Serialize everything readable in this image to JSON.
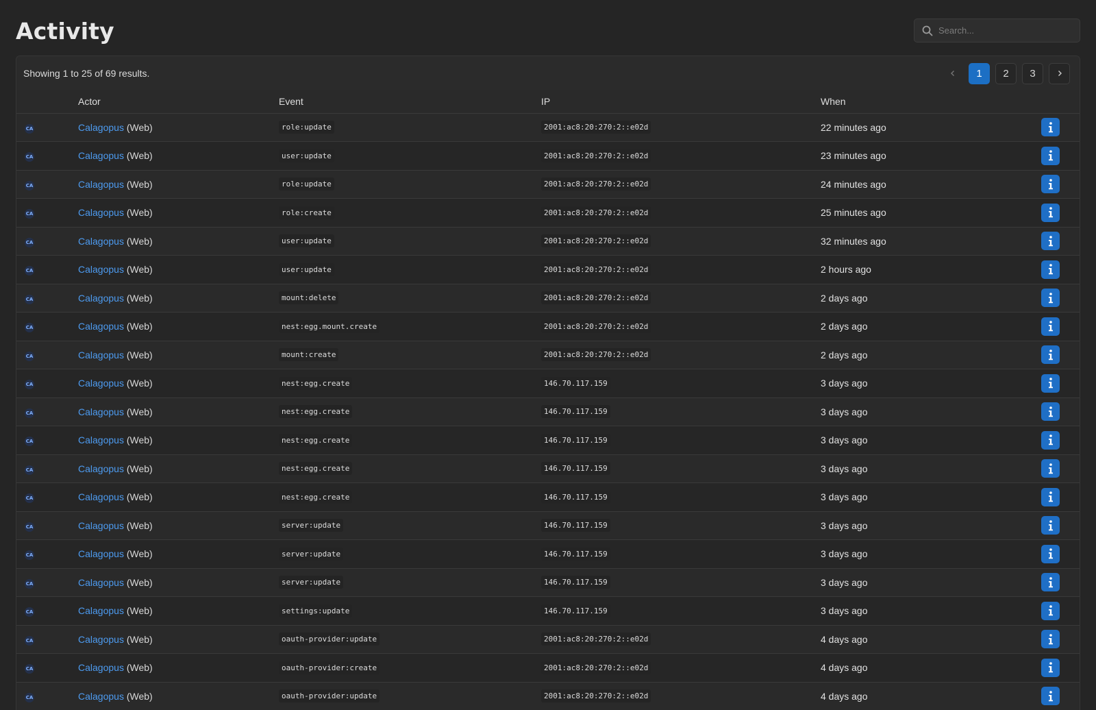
{
  "page": {
    "title": "Activity"
  },
  "search": {
    "placeholder": "Search..."
  },
  "results": {
    "text": "Showing 1 to 25 of 69 results."
  },
  "pagination": {
    "prev_icon": "chevron-left-icon",
    "next_icon": "chevron-right-icon",
    "pages": [
      "1",
      "2",
      "3"
    ],
    "current": "1"
  },
  "table": {
    "columns": {
      "actor": "Actor",
      "event": "Event",
      "ip": "IP",
      "when": "When"
    },
    "rows": [
      {
        "avatar": "CA",
        "actor": "Calagopus",
        "actor_suffix": "(Web)",
        "event": "role:update",
        "ip": "2001:ac8:20:270:2::e02d",
        "when": "22 minutes ago"
      },
      {
        "avatar": "CA",
        "actor": "Calagopus",
        "actor_suffix": "(Web)",
        "event": "user:update",
        "ip": "2001:ac8:20:270:2::e02d",
        "when": "23 minutes ago"
      },
      {
        "avatar": "CA",
        "actor": "Calagopus",
        "actor_suffix": "(Web)",
        "event": "role:update",
        "ip": "2001:ac8:20:270:2::e02d",
        "when": "24 minutes ago"
      },
      {
        "avatar": "CA",
        "actor": "Calagopus",
        "actor_suffix": "(Web)",
        "event": "role:create",
        "ip": "2001:ac8:20:270:2::e02d",
        "when": "25 minutes ago"
      },
      {
        "avatar": "CA",
        "actor": "Calagopus",
        "actor_suffix": "(Web)",
        "event": "user:update",
        "ip": "2001:ac8:20:270:2::e02d",
        "when": "32 minutes ago"
      },
      {
        "avatar": "CA",
        "actor": "Calagopus",
        "actor_suffix": "(Web)",
        "event": "user:update",
        "ip": "2001:ac8:20:270:2::e02d",
        "when": "2 hours ago"
      },
      {
        "avatar": "CA",
        "actor": "Calagopus",
        "actor_suffix": "(Web)",
        "event": "mount:delete",
        "ip": "2001:ac8:20:270:2::e02d",
        "when": "2 days ago"
      },
      {
        "avatar": "CA",
        "actor": "Calagopus",
        "actor_suffix": "(Web)",
        "event": "nest:egg.mount.create",
        "ip": "2001:ac8:20:270:2::e02d",
        "when": "2 days ago"
      },
      {
        "avatar": "CA",
        "actor": "Calagopus",
        "actor_suffix": "(Web)",
        "event": "mount:create",
        "ip": "2001:ac8:20:270:2::e02d",
        "when": "2 days ago"
      },
      {
        "avatar": "CA",
        "actor": "Calagopus",
        "actor_suffix": "(Web)",
        "event": "nest:egg.create",
        "ip": "146.70.117.159",
        "when": "3 days ago"
      },
      {
        "avatar": "CA",
        "actor": "Calagopus",
        "actor_suffix": "(Web)",
        "event": "nest:egg.create",
        "ip": "146.70.117.159",
        "when": "3 days ago"
      },
      {
        "avatar": "CA",
        "actor": "Calagopus",
        "actor_suffix": "(Web)",
        "event": "nest:egg.create",
        "ip": "146.70.117.159",
        "when": "3 days ago"
      },
      {
        "avatar": "CA",
        "actor": "Calagopus",
        "actor_suffix": "(Web)",
        "event": "nest:egg.create",
        "ip": "146.70.117.159",
        "when": "3 days ago"
      },
      {
        "avatar": "CA",
        "actor": "Calagopus",
        "actor_suffix": "(Web)",
        "event": "nest:egg.create",
        "ip": "146.70.117.159",
        "when": "3 days ago"
      },
      {
        "avatar": "CA",
        "actor": "Calagopus",
        "actor_suffix": "(Web)",
        "event": "server:update",
        "ip": "146.70.117.159",
        "when": "3 days ago"
      },
      {
        "avatar": "CA",
        "actor": "Calagopus",
        "actor_suffix": "(Web)",
        "event": "server:update",
        "ip": "146.70.117.159",
        "when": "3 days ago"
      },
      {
        "avatar": "CA",
        "actor": "Calagopus",
        "actor_suffix": "(Web)",
        "event": "server:update",
        "ip": "146.70.117.159",
        "when": "3 days ago"
      },
      {
        "avatar": "CA",
        "actor": "Calagopus",
        "actor_suffix": "(Web)",
        "event": "settings:update",
        "ip": "146.70.117.159",
        "when": "3 days ago"
      },
      {
        "avatar": "CA",
        "actor": "Calagopus",
        "actor_suffix": "(Web)",
        "event": "oauth-provider:update",
        "ip": "2001:ac8:20:270:2::e02d",
        "when": "4 days ago"
      },
      {
        "avatar": "CA",
        "actor": "Calagopus",
        "actor_suffix": "(Web)",
        "event": "oauth-provider:create",
        "ip": "2001:ac8:20:270:2::e02d",
        "when": "4 days ago"
      },
      {
        "avatar": "CA",
        "actor": "Calagopus",
        "actor_suffix": "(Web)",
        "event": "oauth-provider:update",
        "ip": "2001:ac8:20:270:2::e02d",
        "when": "4 days ago"
      }
    ]
  },
  "colors": {
    "background": "#252525",
    "accent": "#1f6fc6",
    "link": "#4d9bf0"
  },
  "icons": {
    "search": "search-icon",
    "info": "info-icon",
    "avatar": "avatar"
  }
}
